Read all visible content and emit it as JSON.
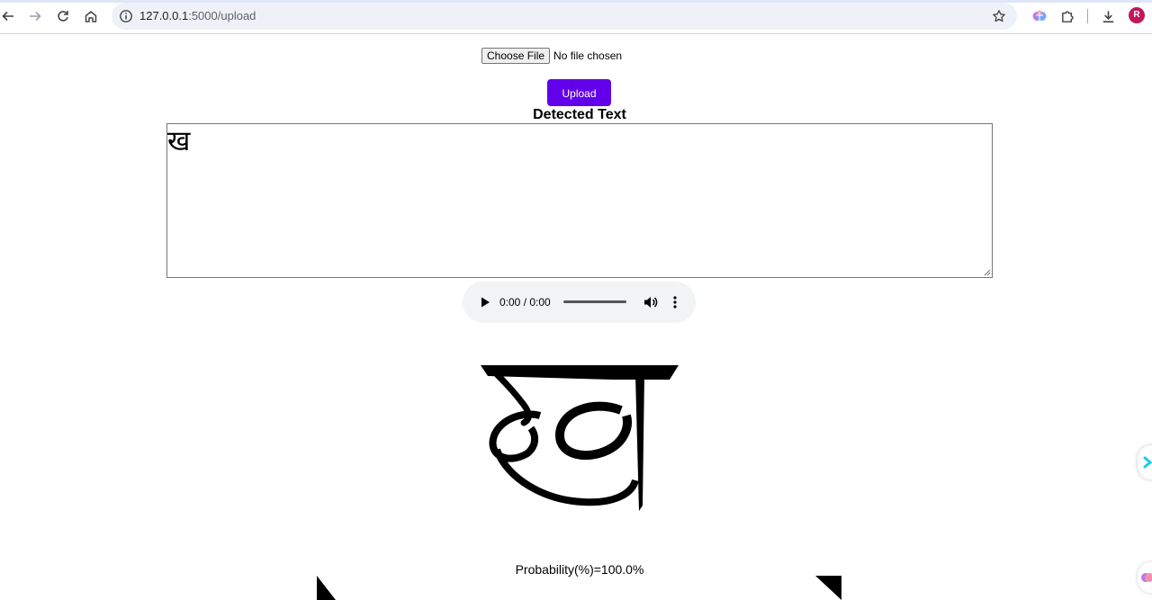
{
  "browser": {
    "url_host": "127.0.0.1",
    "url_path": ":5000/upload",
    "avatar_letter": "R",
    "avatar_color": "#c2185b"
  },
  "form": {
    "choose_file_label": "Choose File",
    "file_status": "No file chosen",
    "upload_label": "Upload",
    "upload_color": "#6200ea"
  },
  "result": {
    "heading": "Detected Text",
    "detected_text": "ख",
    "image_glyph": "ख",
    "probability": "Probability(%)=100.0%"
  },
  "audio": {
    "time": "0:00 / 0:00"
  },
  "icons": {
    "back": "arrow-left-icon",
    "forward": "arrow-right-icon",
    "reload": "reload-icon",
    "home": "home-icon",
    "info": "info-icon",
    "bookmark": "star-icon",
    "extensions": "puzzle-icon",
    "download": "download-icon",
    "play": "play-icon",
    "volume": "volume-icon",
    "more": "more-vertical-icon"
  }
}
